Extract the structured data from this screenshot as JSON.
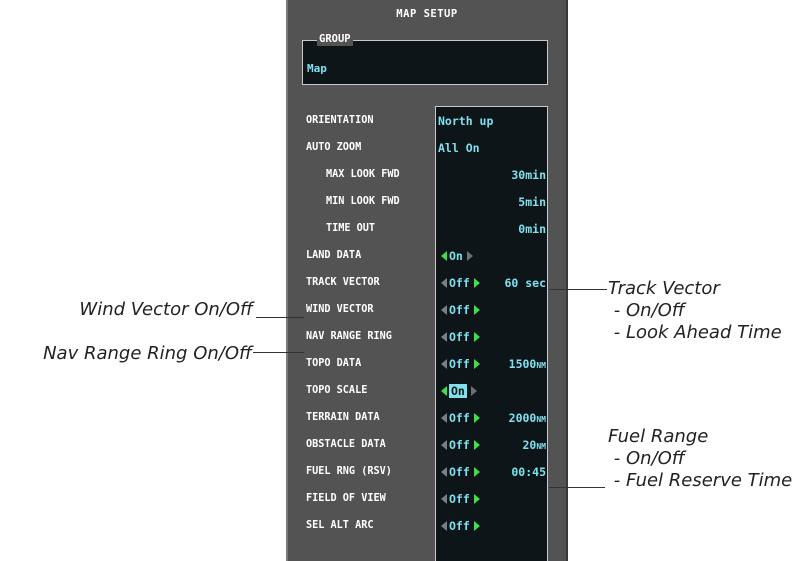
{
  "panel": {
    "title": "MAP SETUP",
    "group_label": "GROUP",
    "group_value": "Map",
    "rows": [
      {
        "label": "ORIENTATION",
        "value": "North up"
      },
      {
        "label": "AUTO ZOOM",
        "value": "All On"
      },
      {
        "label": "MAX LOOK FWD",
        "value": "30min"
      },
      {
        "label": "MIN LOOK FWD",
        "value": "5min"
      },
      {
        "label": "TIME OUT",
        "value": "0min"
      },
      {
        "label": "LAND DATA",
        "value": "On"
      },
      {
        "label": "TRACK VECTOR",
        "value": "Off",
        "secondary": "60 sec"
      },
      {
        "label": "WIND VECTOR",
        "value": "Off"
      },
      {
        "label": "NAV RANGE RING",
        "value": "Off"
      },
      {
        "label": "TOPO DATA",
        "value": "Off",
        "secondary": "1500",
        "unit": "NM"
      },
      {
        "label": "TOPO SCALE",
        "value": "On"
      },
      {
        "label": "TERRAIN DATA",
        "value": "Off",
        "secondary": "2000",
        "unit": "NM"
      },
      {
        "label": "OBSTACLE DATA",
        "value": "Off",
        "secondary": "20",
        "unit": "NM"
      },
      {
        "label": "FUEL RNG (RSV)",
        "value": "Off",
        "secondary": "00:45"
      },
      {
        "label": "FIELD OF VIEW",
        "value": "Off"
      },
      {
        "label": "SEL ALT ARC",
        "value": "Off"
      }
    ]
  },
  "callouts": {
    "wind_vector": "Wind Vector On/Off",
    "nav_range_ring": "Nav Range Ring On/Off",
    "track_vector": [
      "Track Vector",
      " - On/Off",
      " - Look Ahead Time"
    ],
    "fuel_range": [
      "Fuel Range",
      " - On/Off",
      " - Fuel Reserve Time"
    ]
  },
  "colors": {
    "panel_bg": "#535353",
    "field_bg": "#0d1518",
    "value_cyan": "#7fe0ee",
    "arrow_green": "#3ce04a"
  }
}
